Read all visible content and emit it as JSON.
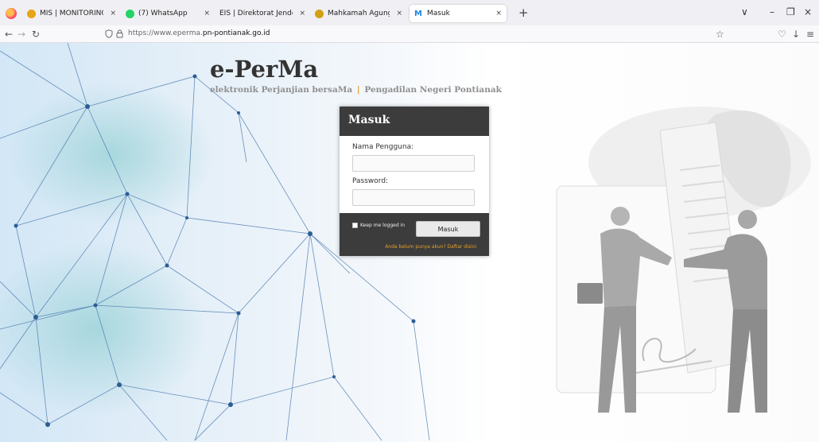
{
  "browser": {
    "tabs": [
      {
        "title": "MIS | MONITORING IMPLEMEN",
        "close": "×",
        "color": "#e8a317"
      },
      {
        "title": "(7) WhatsApp",
        "close": "×",
        "color": "#25d366"
      },
      {
        "title": "EIS | Direktorat Jenderal Badan Perad",
        "close": "×",
        "color": "#9aa0a6"
      },
      {
        "title": "Mahkamah Agung Republik Indo",
        "close": "×",
        "color": "#d4a017"
      },
      {
        "title": "Masuk",
        "close": "×",
        "color": "#1e88e5",
        "icon": "M",
        "active": true
      }
    ],
    "new_tab": "+",
    "url_prefix": "https://www.eperma.",
    "url_domain": "pn-pontianak.go.id",
    "window_controls": {
      "list_all_tabs": "∨",
      "minimize": "–",
      "maximize": "❐",
      "close": "×"
    },
    "nav": {
      "back": "←",
      "forward": "→",
      "reload": "↻",
      "bookmark": "☆",
      "pocket": "♡",
      "download": "↓",
      "menu": "≡"
    }
  },
  "page": {
    "brand": "e-PerMa",
    "tagline_left": "elektronik Perjanjian bersaMa",
    "tagline_sep": "|",
    "tagline_right": "Pengadilan Negeri Pontianak"
  },
  "login": {
    "title": "Masuk",
    "username_label": "Nama Pengguna:",
    "username_value": "",
    "password_label": "Password:",
    "password_value": "",
    "remember_label": "Keep me logged in",
    "submit_label": "Masuk",
    "register_link": "Anda belum punya akun? Daftar disini"
  },
  "colors": {
    "accent": "#e6a117",
    "panel": "#3c3c3c"
  }
}
